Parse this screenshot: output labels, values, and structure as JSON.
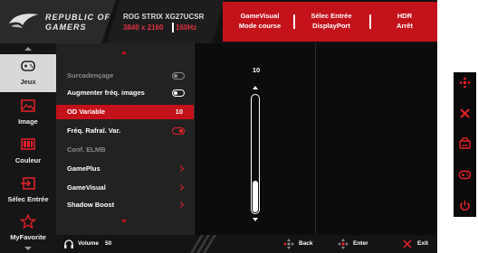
{
  "brand": {
    "line1": "REPUBLIC OF",
    "line2": "GAMERS"
  },
  "model": {
    "name": "ROG STRIX XG27UCSR",
    "resolution": "3840 x 2160",
    "refresh": "160Hz"
  },
  "status": [
    {
      "line1": "GameVisual",
      "line2": "Mode course"
    },
    {
      "line1": "Sélec Entrée",
      "line2": "DisplayPort"
    },
    {
      "line1": "HDR",
      "line2": "Arrêt"
    }
  ],
  "sidebar": {
    "items": [
      {
        "label": "Jeux",
        "icon": "gamepad-icon",
        "active": true
      },
      {
        "label": "Image",
        "icon": "image-icon",
        "active": false
      },
      {
        "label": "Couleur",
        "icon": "color-bars-icon",
        "active": false
      },
      {
        "label": "Sélec Entrée",
        "icon": "input-select-icon",
        "active": false
      },
      {
        "label": "MyFavorite",
        "icon": "star-icon",
        "active": false
      }
    ]
  },
  "menu": {
    "items": [
      {
        "label": "Surcadençage",
        "control": "toggle",
        "state": "off",
        "dim": true
      },
      {
        "label": "Augmenter fréq. images",
        "control": "toggle",
        "state": "off",
        "dim": false
      },
      {
        "label": "OD Variable",
        "control": "value",
        "value": "10",
        "selected": true
      },
      {
        "label": "Fréq. Rafraî. Var.",
        "control": "toggle",
        "state": "on",
        "dim": false
      },
      {
        "label": "Conf. ELMB",
        "control": "none",
        "dim": true
      },
      {
        "label": "GamePlus",
        "control": "chevron",
        "dim": false
      },
      {
        "label": "GameVisual",
        "control": "chevron",
        "dim": false
      },
      {
        "label": "Shadow Boost",
        "control": "chevron",
        "dim": false
      }
    ]
  },
  "slider": {
    "value": "10",
    "fill_fraction": 0.27
  },
  "footer": {
    "volume_label": "Volume",
    "volume_value": "50",
    "back": "Back",
    "enter": "Enter",
    "exit": "Exit"
  },
  "colors": {
    "accent": "#c3121a",
    "panel": "#222222",
    "background": "#0b0b0b"
  }
}
